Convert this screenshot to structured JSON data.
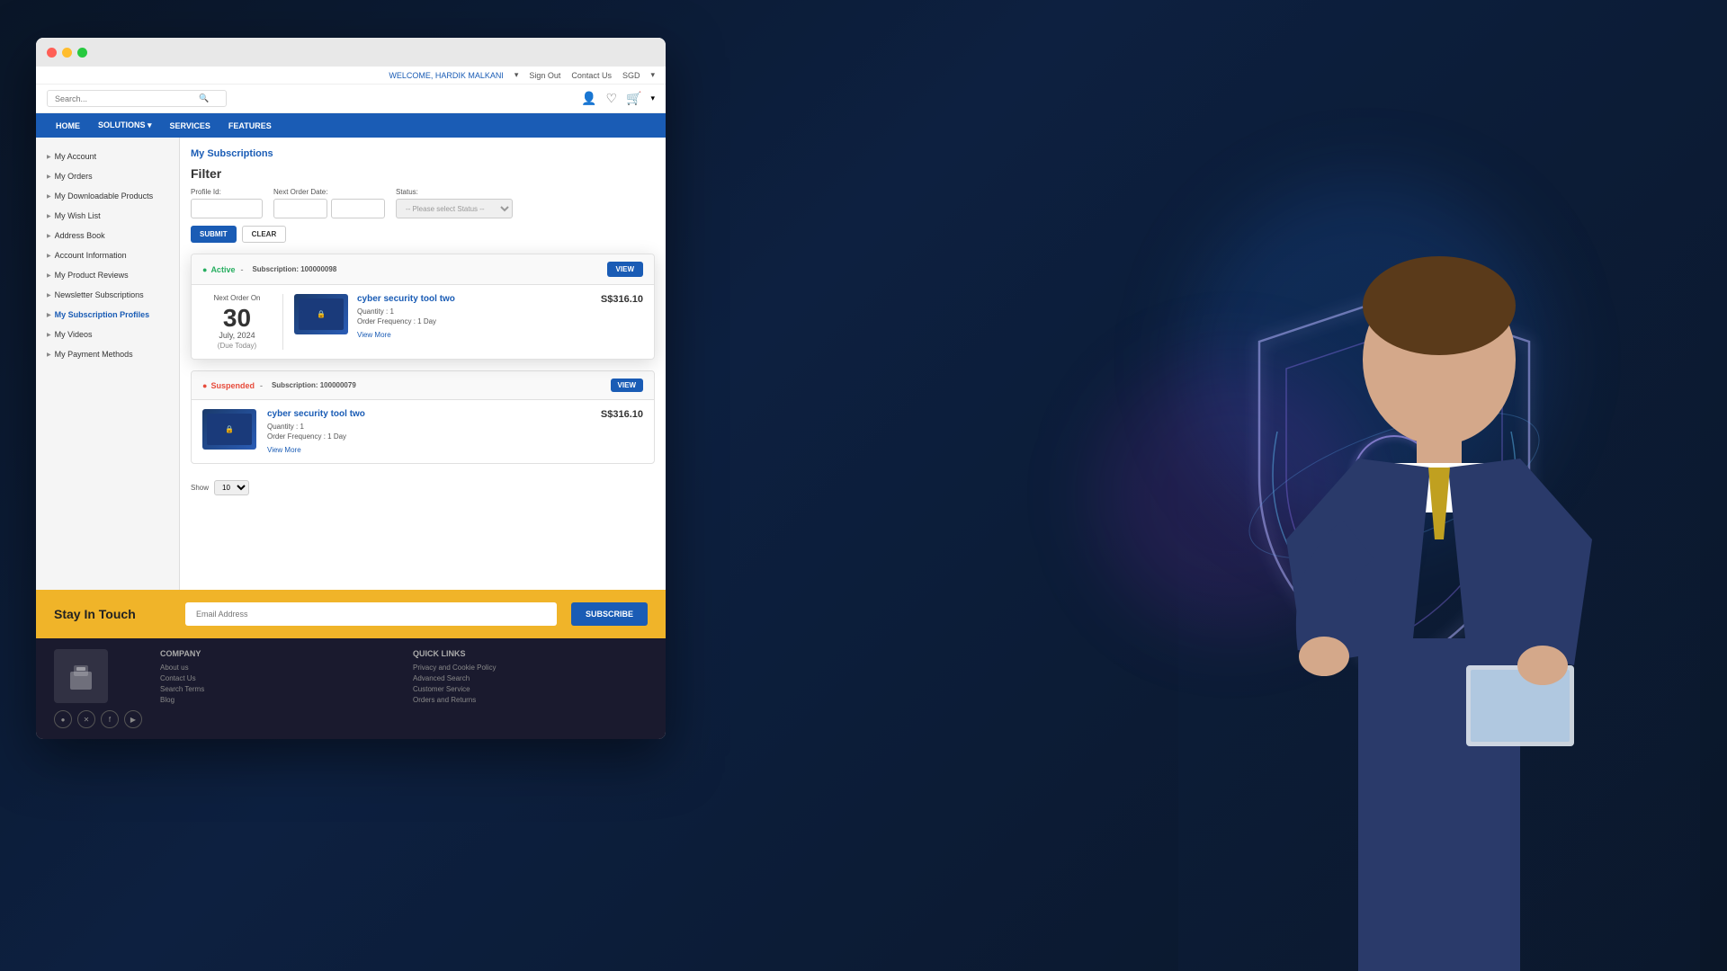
{
  "background": {
    "color": "#0a1628"
  },
  "topbar": {
    "welcome": "WELCOME, HARDIK MALKANI",
    "signout": "Sign Out",
    "contact": "Contact Us",
    "currency": "SGD"
  },
  "header": {
    "search_placeholder": "Search...",
    "search_icon": "🔍"
  },
  "nav": {
    "items": [
      {
        "label": "HOME"
      },
      {
        "label": "SOLUTIONS ▾"
      },
      {
        "label": "SERVICES"
      },
      {
        "label": "FEATURES"
      }
    ]
  },
  "sidebar": {
    "items": [
      {
        "label": "My Account"
      },
      {
        "label": "My Orders"
      },
      {
        "label": "My Downloadable Products"
      },
      {
        "label": "My Wish List"
      },
      {
        "label": "Address Book"
      },
      {
        "label": "Account Information"
      },
      {
        "label": "My Product Reviews"
      },
      {
        "label": "Newsletter Subscriptions"
      },
      {
        "label": "My Subscription Profiles",
        "active": true
      },
      {
        "label": "My Videos"
      },
      {
        "label": "My Payment Methods"
      }
    ]
  },
  "page": {
    "breadcrumb": "My Subscriptions",
    "filter_title": "Filter",
    "filter": {
      "profile_id_label": "Profile Id:",
      "next_order_date_label": "Next Order Date:",
      "status_label": "Status:",
      "profile_id_value": "",
      "date_from": "",
      "date_to": "",
      "status_placeholder": "-- Please select Status --",
      "submit_label": "SUBMIT",
      "clear_label": "CLEAR"
    },
    "subscriptions": [
      {
        "status": "Active",
        "status_type": "active",
        "subscription_id": "Subscription: 100000098",
        "view_label": "VIEW",
        "next_order_label": "Next Order On",
        "date_number": "30",
        "date_month": "July, 2024",
        "date_due": "(Due Today)",
        "product_name": "cyber security tool two",
        "quantity_label": "Quantity :",
        "quantity_value": "1",
        "frequency_label": "Order Frequency :",
        "frequency_value": "1 Day",
        "price": "S$316.10",
        "view_more": "View More"
      },
      {
        "status": "Suspended",
        "status_type": "suspended",
        "subscription_id": "Subscription: 100000079",
        "view_label": "VIEW",
        "product_name": "cyber security tool two",
        "quantity_label": "Quantity :",
        "quantity_value": "1",
        "frequency_label": "Order Frequency :",
        "frequency_value": "1 Day",
        "price": "S$316.10",
        "view_more": "View More"
      }
    ],
    "show_label": "Show",
    "show_value": "10"
  },
  "newsletter": {
    "title": "Stay In Touch",
    "email_placeholder": "Email Address",
    "subscribe_label": "SUBSCRIBE"
  },
  "footer": {
    "company_title": "COMPANY",
    "company_links": [
      "About us",
      "Contact Us",
      "Search Terms",
      "Blog"
    ],
    "quicklinks_title": "QUICK LINKS",
    "quick_links": [
      "Privacy and Cookie Policy",
      "Advanced Search",
      "Customer Service",
      "Orders and Returns"
    ],
    "social_icons": [
      "●",
      "✕",
      "f",
      "▶"
    ]
  }
}
